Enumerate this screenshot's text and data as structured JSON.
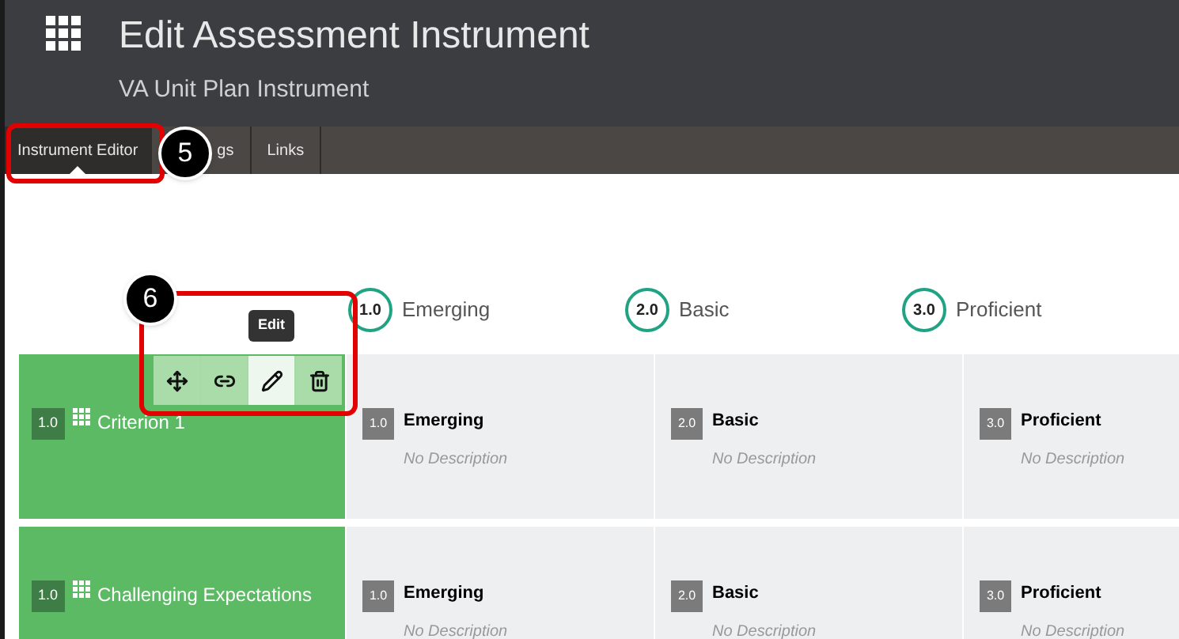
{
  "header": {
    "title": "Edit Assessment Instrument",
    "subtitle": "VA Unit Plan Instrument"
  },
  "tabs": [
    {
      "label": "Instrument Editor",
      "selected": true
    },
    {
      "label": "gs",
      "selected": false
    },
    {
      "label": "Links",
      "selected": false
    }
  ],
  "callouts": [
    {
      "label": "5"
    },
    {
      "label": "6"
    }
  ],
  "levels": [
    {
      "score": "1.0",
      "name": "Emerging"
    },
    {
      "score": "2.0",
      "name": "Basic"
    },
    {
      "score": "3.0",
      "name": "Proficient"
    }
  ],
  "toolbar": {
    "tooltip": "Edit",
    "actions": [
      {
        "kind": "move",
        "selected": false
      },
      {
        "kind": "link",
        "selected": false
      },
      {
        "kind": "edit",
        "selected": true
      },
      {
        "kind": "delete",
        "selected": false
      }
    ]
  },
  "criteria": [
    {
      "score": "1.0",
      "name": "Criterion 1",
      "cells": [
        {
          "score": "1.0",
          "name": "Emerging",
          "description": "No Description"
        },
        {
          "score": "2.0",
          "name": "Basic",
          "description": "No Description"
        },
        {
          "score": "3.0",
          "name": "Proficient",
          "description": "No Description"
        }
      ]
    },
    {
      "score": "1.0",
      "name": "Challenging Expectations",
      "cells": [
        {
          "score": "1.0",
          "name": "Emerging",
          "description": "No Description"
        },
        {
          "score": "2.0",
          "name": "Basic",
          "description": "No Description"
        },
        {
          "score": "3.0",
          "name": "Proficient",
          "description": "No Description"
        }
      ]
    }
  ]
}
